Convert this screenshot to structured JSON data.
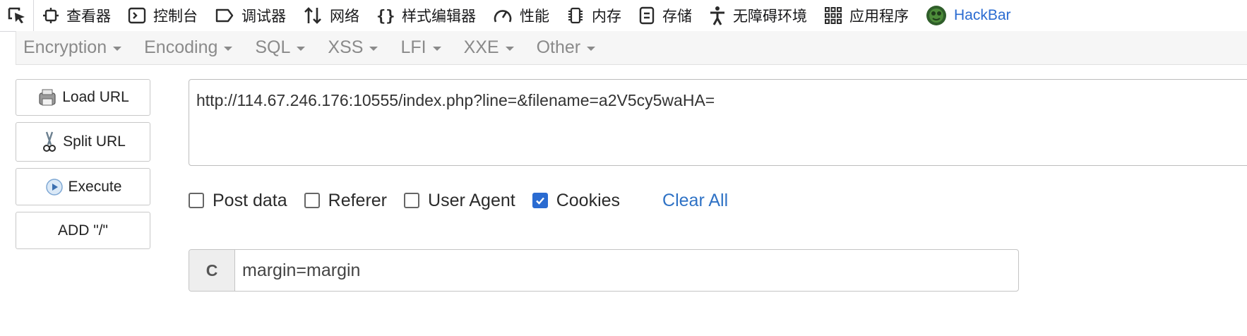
{
  "devtools": {
    "tabs": [
      {
        "label": "查看器",
        "icon": "inspector-icon"
      },
      {
        "label": "控制台",
        "icon": "console-icon"
      },
      {
        "label": "调试器",
        "icon": "debugger-icon"
      },
      {
        "label": "网络",
        "icon": "network-icon"
      },
      {
        "label": "样式编辑器",
        "icon": "style-editor-icon"
      },
      {
        "label": "性能",
        "icon": "performance-icon"
      },
      {
        "label": "内存",
        "icon": "memory-icon"
      },
      {
        "label": "存储",
        "icon": "storage-icon"
      },
      {
        "label": "无障碍环境",
        "icon": "accessibility-icon"
      },
      {
        "label": "应用程序",
        "icon": "application-icon"
      },
      {
        "label": "HackBar",
        "icon": "hackbar-logo-icon"
      }
    ]
  },
  "menu": {
    "items": [
      "Encryption",
      "Encoding",
      "SQL",
      "XSS",
      "LFI",
      "XXE",
      "Other"
    ]
  },
  "buttons": {
    "load_url": "Load URL",
    "split_url": "Split URL",
    "execute": "Execute",
    "add_slash": "ADD \"/\""
  },
  "url": {
    "value": "http://114.67.246.176:10555/index.php?line=&filename=a2V5cy5waHA="
  },
  "options": {
    "post_data": {
      "label": "Post data",
      "checked": false
    },
    "referer": {
      "label": "Referer",
      "checked": false
    },
    "user_agent": {
      "label": "User Agent",
      "checked": false
    },
    "cookies": {
      "label": "Cookies",
      "checked": true
    },
    "clear_all": "Clear All"
  },
  "cookie": {
    "prefix": "C",
    "value": "margin=margin"
  },
  "colors": {
    "accent": "#2a6bd1",
    "link": "#2f72c5",
    "menu_text": "#8a8a8a"
  }
}
